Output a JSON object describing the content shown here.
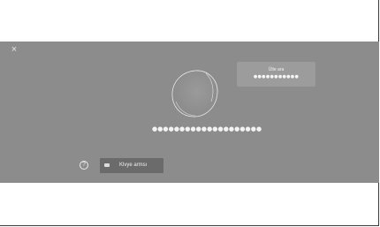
{
  "screen": {
    "close_icon": "×",
    "user_card": {
      "title": "Ülte ara",
      "password_mask": "●●●●●●●●●●●"
    },
    "password_mask": "●●●●●●●●●●●●●●●●●●●●",
    "help_icon": "?",
    "keyboard_button": {
      "icon": "keyboard-icon",
      "label": "Klvye armsı"
    }
  },
  "colors": {
    "screen_bg": "#8c8c8c",
    "button_bg": "#6b6b6b",
    "card_bg": "#9c9c9c"
  }
}
